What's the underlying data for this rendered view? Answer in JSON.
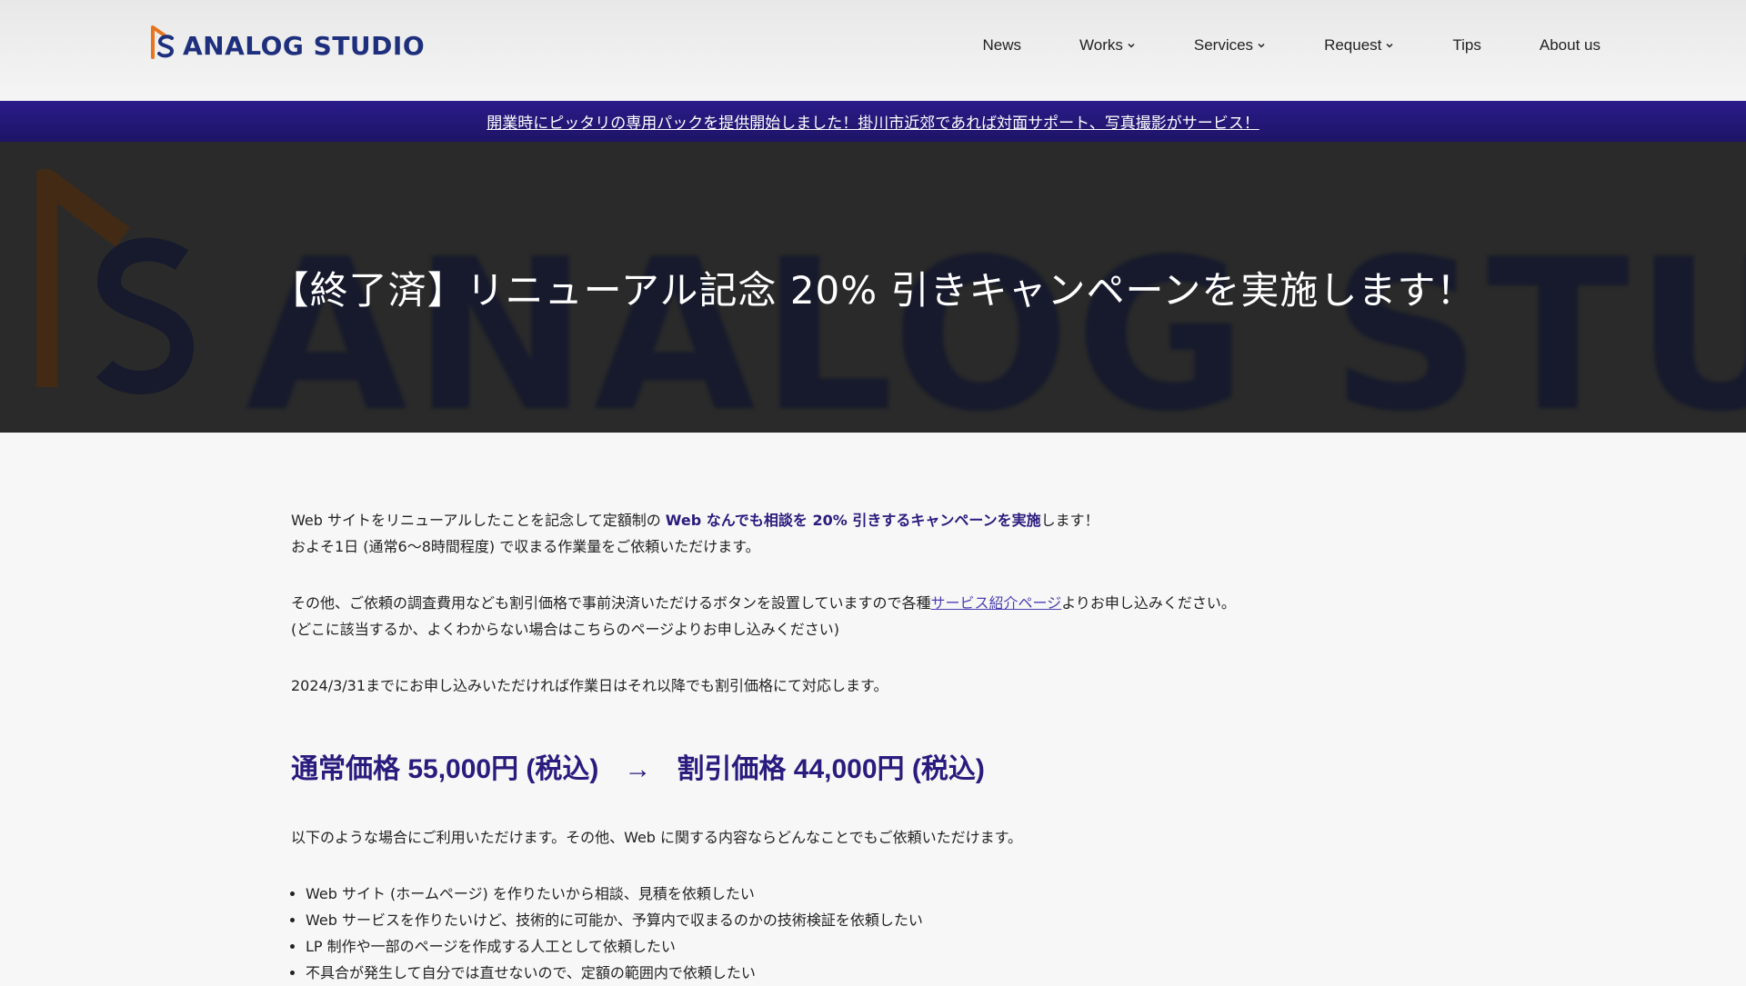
{
  "header": {
    "logo_text": "ANALOG STUDIO",
    "nav": [
      {
        "label": "News",
        "dropdown": false
      },
      {
        "label": "Works",
        "dropdown": true
      },
      {
        "label": "Services",
        "dropdown": true
      },
      {
        "label": "Request",
        "dropdown": true
      },
      {
        "label": "Tips",
        "dropdown": false
      },
      {
        "label": "About us",
        "dropdown": false
      }
    ]
  },
  "announcement": {
    "text": "開業時にピッタリの専用パックを提供開始しました！掛川市近郊であれば対面サポート、写真撮影がサービス！"
  },
  "hero": {
    "title": "【終了済】リニューアル記念 20% 引きキャンペーンを実施します！",
    "background_text": "ANALOG STUDIO"
  },
  "article": {
    "p1_a": "Web サイトをリニューアルしたことを記念して定額制の ",
    "p1_strong": "Web なんでも相談を 20% 引きするキャンペーンを実施",
    "p1_b": "します！",
    "p2": "およそ1日 (通常6〜8時間程度) で収まる作業量をご依頼いただけます。",
    "p3_a": "その他、ご依頼の調査費用なども割引価格で事前決済いただけるボタンを設置していますので各種",
    "p3_link": "サービス紹介ページ",
    "p3_b": "よりお申し込みください。",
    "p4": "(どこに該当するか、よくわからない場合はこちらのページよりお申し込みください)",
    "p5": "2024/3/31までにお申し込みいただければ作業日はそれ以降でも割引価格にて対応します。",
    "price_regular": "通常価格 55,000円 (税込)",
    "price_arrow": "→",
    "price_discount": "割引価格 44,000円 (税込)",
    "p6": "以下のような場合にご利用いただけます。その他、Web に関する内容ならどんなことでもご依頼いただけます。",
    "uses": [
      "Web サイト (ホームページ) を作りたいから相談、見積を依頼したい",
      "Web サービスを作りたいけど、技術的に可能か、予算内で収まるのかの技術検証を依頼したい",
      "LP 制作や一部のページを作成する人工として依頼したい",
      "不具合が発生して自分では直せないので、定額の範囲内で依頼したい"
    ]
  },
  "colors": {
    "brand_navy": "#1e2f7d",
    "brand_orange": "#e8741c",
    "accent_purple": "#2a1b7e",
    "announce_bg": "#24188a"
  }
}
